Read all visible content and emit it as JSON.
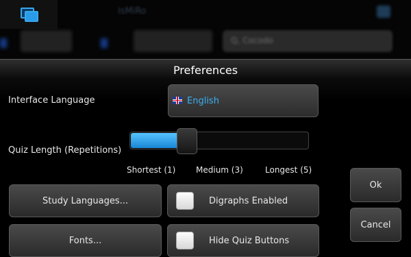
{
  "background_app": {
    "title": "lsMiRo",
    "search_placeholder": "Q, Cocodo"
  },
  "dialog": {
    "title": "Preferences",
    "interface_language": {
      "label": "Interface Language",
      "value": "English",
      "flag_icon": "uk-flag-icon"
    },
    "quiz_length": {
      "label": "Quiz Length (Repetitions)",
      "ticks": [
        "Shortest (1)",
        "Medium (3)",
        "Longest (5)"
      ],
      "value_fraction": 0.27
    },
    "buttons": {
      "study_languages": "Study Languages...",
      "fonts": "Fonts...",
      "ok": "Ok",
      "cancel": "Cancel"
    },
    "checkboxes": {
      "digraphs_enabled": {
        "label": "Digraphs Enabled",
        "checked": false
      },
      "hide_quiz_buttons": {
        "label": "Hide Quiz Buttons",
        "checked": false
      }
    }
  },
  "colors": {
    "accent": "#3ab0f2",
    "slider_fill": "#2a9be9"
  }
}
